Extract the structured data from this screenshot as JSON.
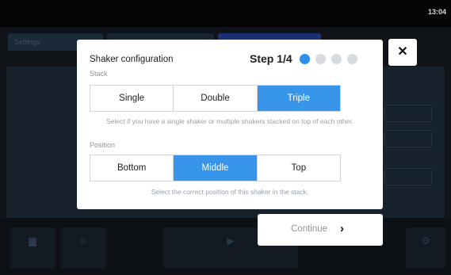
{
  "status_bar": {
    "clock": "13:04"
  },
  "background": {
    "tabs": [
      "Settings",
      "",
      ""
    ],
    "bottom_bar": {
      "icons": [
        "folder-icon",
        "list-icon",
        "play-icon",
        "gear-icon"
      ]
    }
  },
  "modal": {
    "title": "Shaker configuration",
    "step_label": "Step 1/4",
    "steps_total": 4,
    "current_step": 1,
    "colors": {
      "accent": "#3796ea",
      "dot_active": "#2d8fe8",
      "dot_inactive": "#d7dbe0"
    },
    "stack": {
      "label": "Stack",
      "options": [
        "Single",
        "Double",
        "Triple"
      ],
      "selected": "Triple",
      "help": "Select if you have a single shaker or multiple shakers stacked on top of each other."
    },
    "position": {
      "label": "Position",
      "options": [
        "Bottom",
        "Middle",
        "Top"
      ],
      "selected": "Middle",
      "help": "Select the correct position of this shaker in the stack."
    },
    "close_label": "✕",
    "continue_label": "Continue",
    "continue_chevron": "›"
  }
}
